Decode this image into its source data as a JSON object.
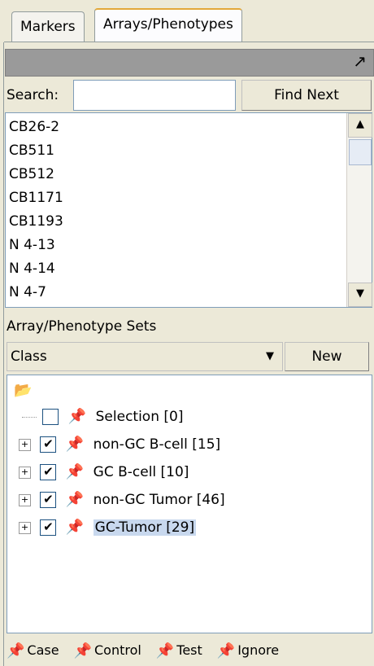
{
  "tabs": [
    {
      "label": "Markers"
    },
    {
      "label": "Arrays/Phenotypes"
    }
  ],
  "toolbar": {
    "icon": "expand-arrow-icon"
  },
  "search": {
    "label": "Search:",
    "value": "",
    "find_next_label": "Find Next"
  },
  "arrays": [
    "CB26-2",
    "CB511",
    "CB512",
    "CB1171",
    "CB1193",
    "N 4-13",
    "N 4-14",
    "N 4-7"
  ],
  "sets": {
    "header": "Array/Phenotype Sets",
    "class_select": "Class",
    "new_label": "New",
    "tree": [
      {
        "label": "Selection [0]",
        "checked": false
      },
      {
        "label": "non-GC B-cell [15]",
        "checked": true
      },
      {
        "label": "GC B-cell [10]",
        "checked": true
      },
      {
        "label": "non-GC Tumor [46]",
        "checked": true
      },
      {
        "label": "GC-Tumor [29]",
        "checked": true,
        "selected": true
      }
    ]
  },
  "legend": [
    {
      "label": "Case",
      "color": "#c00000"
    },
    {
      "label": "Control",
      "color": "#000000"
    },
    {
      "label": "Test",
      "color": "#008000"
    },
    {
      "label": "Ignore",
      "color": "#000000"
    }
  ]
}
